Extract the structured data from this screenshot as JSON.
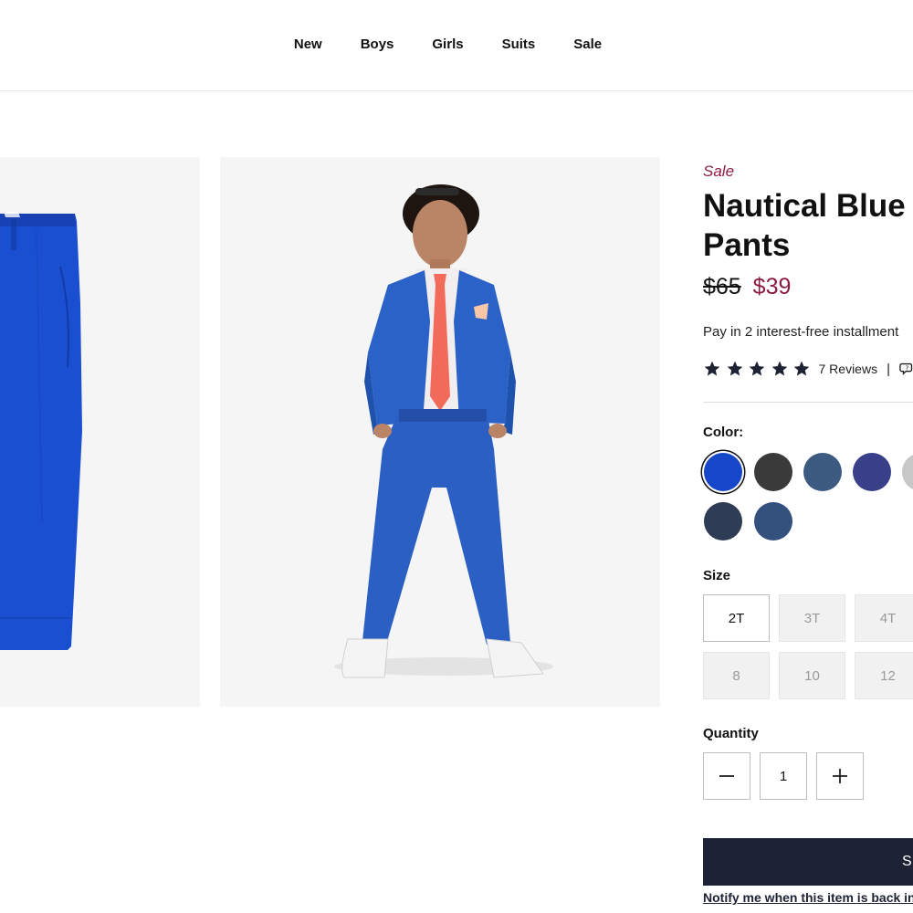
{
  "nav": {
    "items": [
      "New",
      "Boys",
      "Girls",
      "Suits",
      "Sale"
    ]
  },
  "product": {
    "sale_label": "Sale",
    "title_line1": "Nautical Blue S",
    "title_line2": "Pants",
    "price_original": "$65",
    "price_sale": "$39",
    "installments_text": "Pay in 2 interest-free installment",
    "rating_stars": 5,
    "reviews_text": "7 Reviews",
    "separator": "|"
  },
  "colors": {
    "label": "Color:",
    "swatches": [
      {
        "name": "royal-blue",
        "hex": "#1747c9",
        "selected": true
      },
      {
        "name": "charcoal",
        "hex": "#3a3a3a",
        "selected": false
      },
      {
        "name": "slate-blue-tweed",
        "hex": "#3d5a80",
        "selected": false
      },
      {
        "name": "navy-plaid",
        "hex": "#3a3f8a",
        "selected": false
      },
      {
        "name": "light-grey",
        "hex": "#c7c7c7",
        "selected": false
      },
      {
        "name": "dark-navy-check",
        "hex": "#2e3c55",
        "selected": false
      },
      {
        "name": "denim-blue",
        "hex": "#34507d",
        "selected": false
      }
    ]
  },
  "sizes": {
    "label": "Size",
    "options": [
      {
        "label": "2T",
        "available": true
      },
      {
        "label": "3T",
        "available": false
      },
      {
        "label": "4T",
        "available": false
      },
      {
        "label": "8",
        "available": false
      },
      {
        "label": "10",
        "available": false
      },
      {
        "label": "12",
        "available": false
      }
    ]
  },
  "quantity": {
    "label": "Quantity",
    "value": "1",
    "minus": "−",
    "plus": "+"
  },
  "actions": {
    "submit_label": "S",
    "notify_text": "Notify me when this item is back in"
  },
  "theme": {
    "sale_color": "#8c1b40",
    "button_color": "#1e2235",
    "star_color": "#1e2235"
  }
}
